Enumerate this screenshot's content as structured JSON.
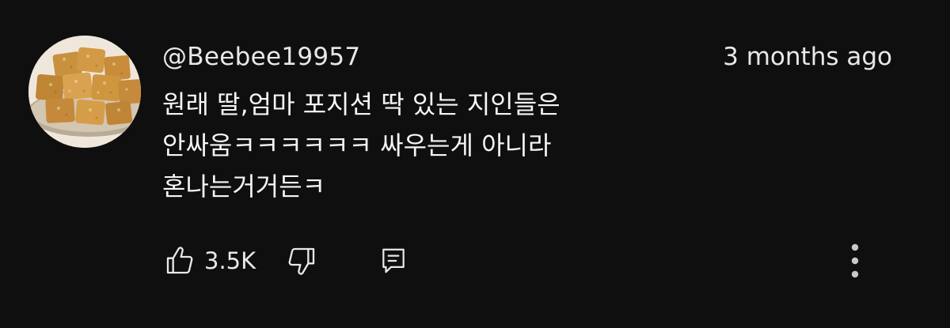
{
  "comment": {
    "author": "@Beebee19957",
    "timestamp": "3 months ago",
    "lines": [
      "원래 딸,엄마 포지션 딱 있는 지인들은",
      "안싸움ㅋㅋㅋㅋㅋㅋ 싸우는게 아니라",
      "혼나는거거든ㅋ"
    ],
    "like_count": "3.5K"
  },
  "icons": {
    "like": "thumbs-up-icon",
    "dislike": "thumbs-down-icon",
    "reply": "reply-comment-icon",
    "more": "more-vertical-icon"
  },
  "colors": {
    "background": "#0f0f0f",
    "text": "#f1f1f1",
    "icon": "#e8e8e8"
  }
}
